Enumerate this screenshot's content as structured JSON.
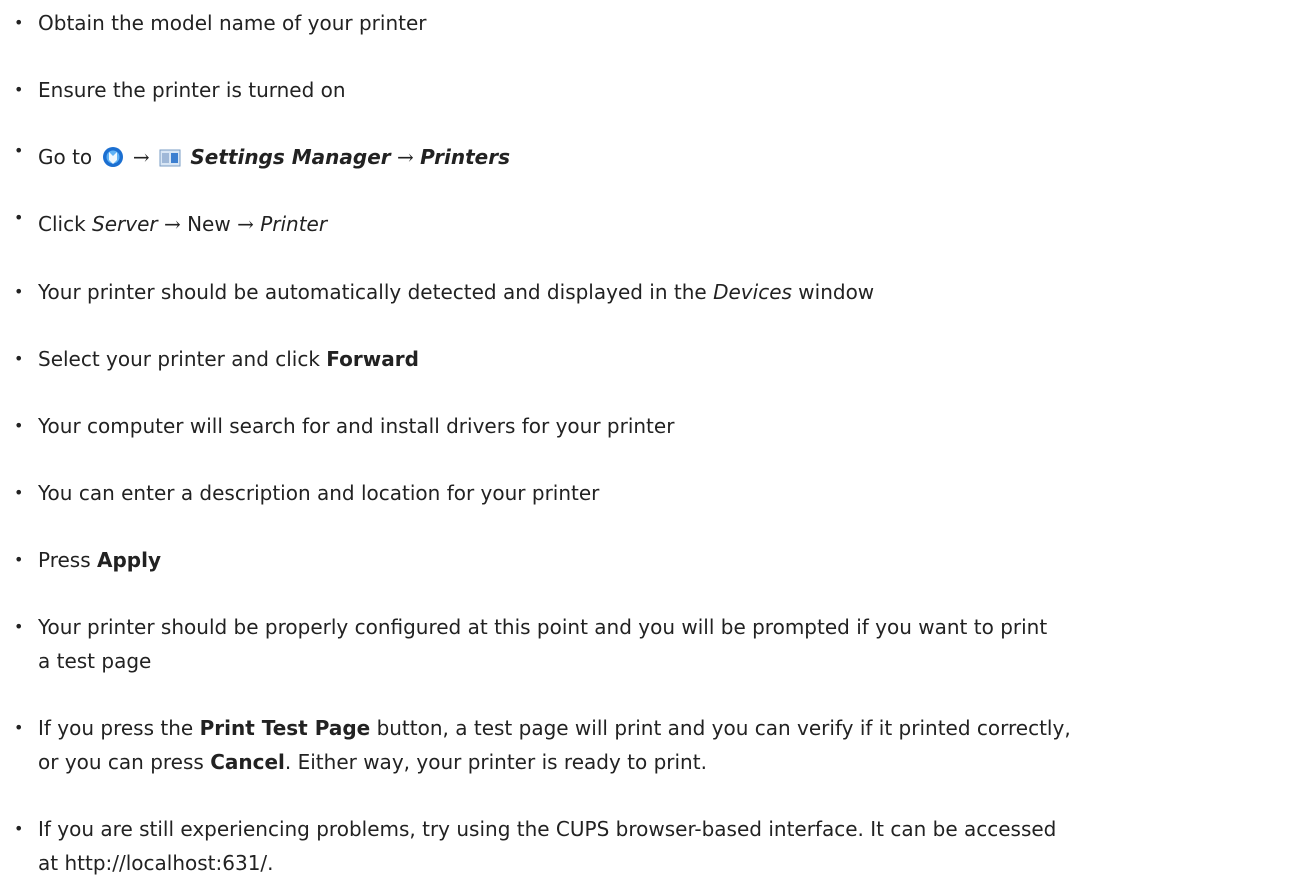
{
  "steps": [
    {
      "text": "Obtain the model name of your printer"
    },
    {
      "text": "Ensure the printer is turned on"
    },
    {
      "prefix": "Go to",
      "arrow1": "→",
      "arrow2": "→",
      "settings_manager": "Settings Manager",
      "printers": "Printers",
      "icon1": "kde-menu-icon",
      "icon2": "settings-manager-icon"
    },
    {
      "prefix": "Click",
      "server": "Server",
      "arrow1": "→",
      "new": "New",
      "arrow2": "→",
      "printer": "Printer"
    },
    {
      "text1": "Your printer should be automatically detected and displayed in the",
      "devices": "Devices",
      "text2": "window"
    },
    {
      "text1": "Select your printer and click",
      "forward": "Forward"
    },
    {
      "text": "Your computer will search for and install drivers for your printer"
    },
    {
      "text": "You can enter a description and location for your printer"
    },
    {
      "text1": "Press",
      "apply": "Apply"
    },
    {
      "line1": "Your printer should be properly configured at this point and you will be prompted if you want to print",
      "line2": "a test page"
    },
    {
      "text1": "If you press the",
      "print_test_page": "Print Test Page",
      "text2": "button, a test page will print and you can verify if it printed correctly,",
      "text3": "or you can press",
      "cancel": "Cancel",
      "text4": ". Either way, your printer is ready to print."
    },
    {
      "line1": "If you are still experiencing problems, try using the CUPS browser-based interface. It can be accessed",
      "line2": "at http://localhost:631/."
    }
  ],
  "bullet": "•",
  "colors": {
    "text": "#222222",
    "icon_blue": "#1b6fd1"
  }
}
